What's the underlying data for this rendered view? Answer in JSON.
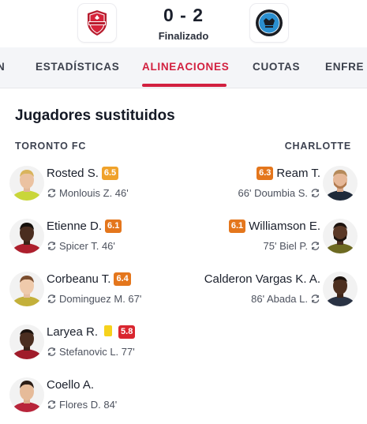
{
  "match": {
    "score": "0 - 2",
    "status": "Finalizado",
    "home_crest": "toronto-fc-crest",
    "away_crest": "charlotte-fc-crest"
  },
  "tabs": [
    {
      "label": "N",
      "active": false
    },
    {
      "label": "ESTADÍSTICAS",
      "active": false
    },
    {
      "label": "ALINEACIONES",
      "active": true
    },
    {
      "label": "CUOTAS",
      "active": false
    },
    {
      "label": "ENFRE",
      "active": false
    }
  ],
  "section": {
    "title": "Jugadores sustituidos",
    "home_team": "TORONTO FC",
    "away_team": "CHARLOTTE"
  },
  "home_subs": [
    {
      "name": "Rosted S.",
      "rating": "6.5",
      "rating_color": "#f0a22a",
      "replaced": "Monlouis Z. 46'",
      "icon": "substitution-icon"
    },
    {
      "name": "Etienne D.",
      "rating": "6.1",
      "rating_color": "#e4761c",
      "replaced": "Spicer T. 46'",
      "icon": "substitution-icon"
    },
    {
      "name": "Corbeanu T.",
      "rating": "6.4",
      "rating_color": "#e4761c",
      "replaced": "Dominguez M. 67'",
      "icon": "substitution-icon"
    },
    {
      "name": "Laryea R.",
      "rating": "5.8",
      "rating_color": "#d9262f",
      "yellow_card": true,
      "replaced": "Stefanovic L. 77'",
      "icon": "substitution-icon"
    },
    {
      "name": "Coello A.",
      "rating": "",
      "replaced": "Flores D. 84'",
      "icon": "substitution-icon"
    }
  ],
  "away_subs": [
    {
      "name": "Ream T.",
      "rating": "6.3",
      "rating_color": "#e4761c",
      "replaced": "66' Doumbia S.",
      "icon": "substitution-icon"
    },
    {
      "name": "Williamson E.",
      "rating": "6.1",
      "rating_color": "#e4761c",
      "replaced": "75' Biel P.",
      "icon": "substitution-icon"
    },
    {
      "name": "Calderon Vargas K. A.",
      "rating": "",
      "replaced": "86' Abada L.",
      "icon": "substitution-icon"
    }
  ],
  "colors": {
    "accent": "#d2203f",
    "rating_amber": "#f0a22a",
    "rating_orange": "#e4761c",
    "rating_red": "#d9262f",
    "yellow_card": "#f6d21c"
  }
}
